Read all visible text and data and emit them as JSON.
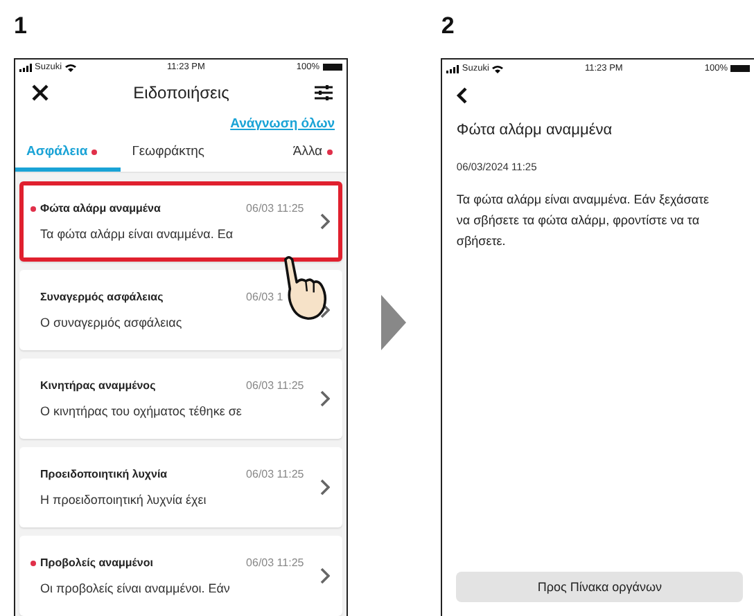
{
  "step_labels": [
    "1",
    "2"
  ],
  "list_screen": {
    "status_bar": {
      "carrier": "Suzuki",
      "time": "11:23 PM",
      "battery": "100%"
    },
    "title": "Ειδοποιήσεις",
    "mark_all_read": "Ανάγνωση όλων",
    "tabs": [
      {
        "label": "Ασφάλεια",
        "selected": true,
        "unread": true
      },
      {
        "label": "Γεωφράκτης",
        "selected": false,
        "unread": false
      },
      {
        "label": "Άλλα",
        "selected": false,
        "unread": true
      }
    ],
    "notifications": [
      {
        "title": "Φώτα αλάρμ αναμμένα",
        "time": "06/03 11:25",
        "body": "Τα φώτα αλάρμ είναι αναμμένα. Εα",
        "unread": true,
        "highlighted": true
      },
      {
        "title": "Συναγερμός ασφάλειας",
        "time": "06/03 1",
        "body": "Ο συναγερμός ασφάλειας",
        "unread": false,
        "highlighted": false
      },
      {
        "title": "Κινητήρας αναμμένος",
        "time": "06/03 11:25",
        "body": "Ο κινητήρας του οχήματος τέθηκε σε",
        "unread": false,
        "highlighted": false
      },
      {
        "title": "Προειδοποιητική λυχνία",
        "time": "06/03 11:25",
        "body": "Η προειδοποιητική λυχνία έχει",
        "unread": false,
        "highlighted": false
      },
      {
        "title": "Προβολείς αναμμένοι",
        "time": "06/03 11:25",
        "body": "Οι προβολείς είναι αναμμένοι. Εάν",
        "unread": true,
        "highlighted": false
      }
    ]
  },
  "detail_screen": {
    "status_bar": {
      "carrier": "Suzuki",
      "time": "11:23 PM",
      "battery": "100%"
    },
    "title": "Φώτα αλάρμ αναμμένα",
    "date": "06/03/2024 11:25",
    "body": "Τα φώτα αλάρμ είναι αναμμένα. Εάν ξεχάσατε να σβήσετε τα φώτα αλάρμ, φροντίστε να τα σβήσετε.",
    "button": "Προς Πίνακα οργάνων"
  }
}
